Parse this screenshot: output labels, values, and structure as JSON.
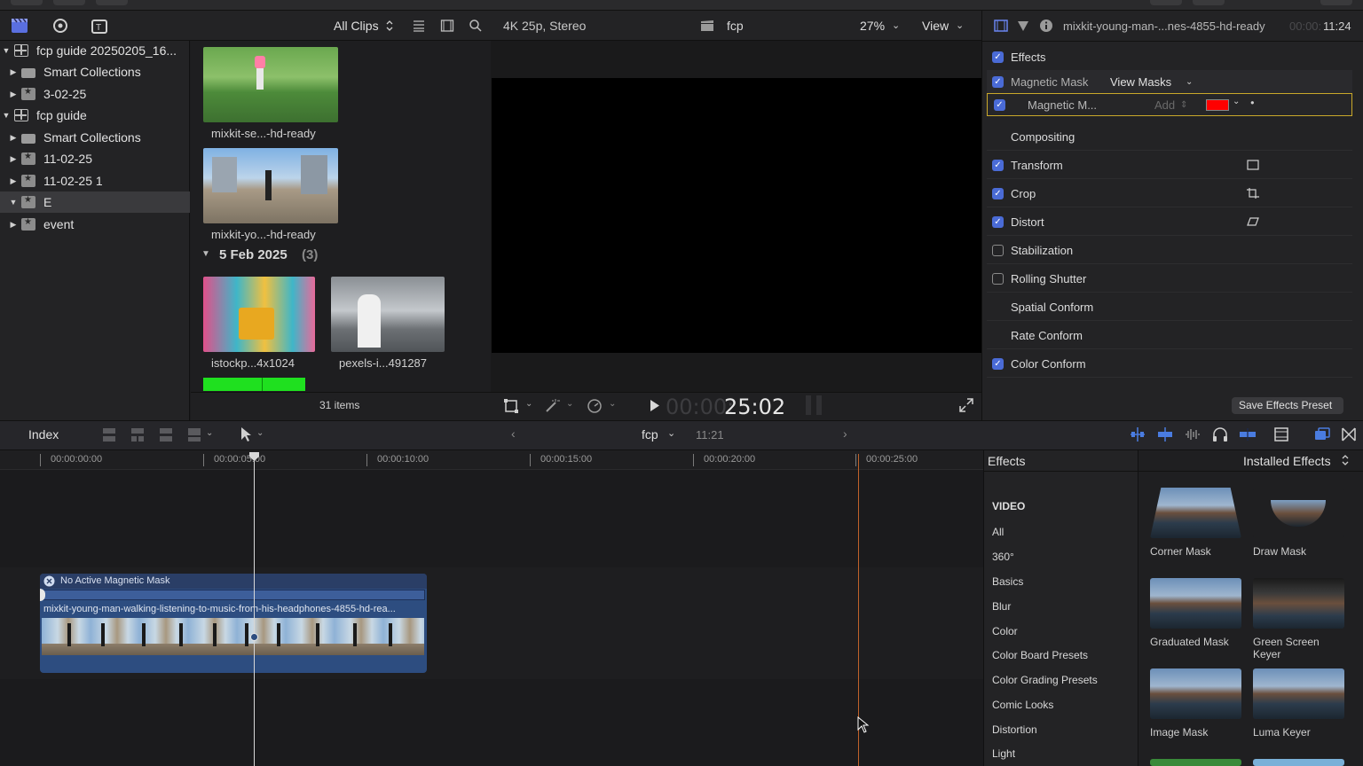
{
  "libraries": {
    "items": [
      {
        "label": "fcp guide 20250205_16...",
        "icon": "library-icon",
        "expanded": true
      },
      {
        "label": "Smart Collections",
        "icon": "folder-icon"
      },
      {
        "label": "3-02-25",
        "icon": "event-icon"
      },
      {
        "label": "fcp guide",
        "icon": "library-icon",
        "expanded": true
      },
      {
        "label": "Smart Collections",
        "icon": "folder-icon"
      },
      {
        "label": "11-02-25",
        "icon": "event-icon"
      },
      {
        "label": "11-02-25 1",
        "icon": "event-icon"
      },
      {
        "label": "E",
        "icon": "event-icon",
        "selected": true,
        "expanded": true
      },
      {
        "label": "event",
        "icon": "event-icon"
      }
    ]
  },
  "browser": {
    "filter_label": "All Clips",
    "clips": [
      {
        "label": "mixkit-se...-hd-ready"
      },
      {
        "label": "mixkit-yo...-hd-ready"
      },
      {
        "label": "istockp...4x1024"
      },
      {
        "label": "pexels-i...491287"
      }
    ],
    "date_group": "5 Feb 2025",
    "date_count": "(3)",
    "item_count": "31 items"
  },
  "viewer": {
    "format": "4K 25p, Stereo",
    "project": "fcp",
    "zoom": "27%",
    "view_label": "View",
    "timecode_dim": "00:00:",
    "timecode": "25:02"
  },
  "inspector": {
    "clip_name": "mixkit-young-man-...nes-4855-hd-ready",
    "clip_time_dim": "00:00:",
    "clip_time": "11:24",
    "rows": [
      {
        "label": "Effects",
        "checkbox": "on"
      },
      {
        "label": "Magnetic Mask",
        "checkbox": "on",
        "extra": "View Masks"
      },
      {
        "label": "Magnetic M...",
        "checkbox": "on",
        "extra": "Add",
        "highlight": true
      },
      {
        "label": "Compositing",
        "checkbox": "none"
      },
      {
        "label": "Transform",
        "checkbox": "on",
        "icon": "transform-icon"
      },
      {
        "label": "Crop",
        "checkbox": "on",
        "icon": "crop-icon"
      },
      {
        "label": "Distort",
        "checkbox": "on",
        "icon": "distort-icon"
      },
      {
        "label": "Stabilization",
        "checkbox": "off"
      },
      {
        "label": "Rolling Shutter",
        "checkbox": "off"
      },
      {
        "label": "Spatial Conform",
        "checkbox": "none"
      },
      {
        "label": "Rate Conform",
        "checkbox": "none"
      },
      {
        "label": "Color Conform",
        "checkbox": "on"
      }
    ],
    "save_preset_label": "Save Effects Preset",
    "mask_color": "#ff0000"
  },
  "timeline": {
    "index_label": "Index",
    "project_name": "fcp",
    "duration": "11:21",
    "ruler": [
      "00:00:00:00",
      "00:00:05:00",
      "00:00:10:00",
      "00:00:15:00",
      "00:00:20:00",
      "00:00:25:00"
    ],
    "effect_label": "No Active Magnetic Mask",
    "clip_name": "mixkit-young-man-walking-listening-to-music-from-his-headphones-4855-hd-rea..."
  },
  "effects_browser": {
    "title": "Effects",
    "filter": "Installed Effects",
    "section": "VIDEO",
    "categories": [
      "All",
      "360°",
      "Basics",
      "Blur",
      "Color",
      "Color Board Presets",
      "Color Grading Presets",
      "Comic Looks",
      "Distortion",
      "Light"
    ],
    "effects": [
      "Corner Mask",
      "Draw Mask",
      "Graduated Mask",
      "Green Screen\nKeyer",
      "Image Mask",
      "Luma Keyer"
    ]
  }
}
